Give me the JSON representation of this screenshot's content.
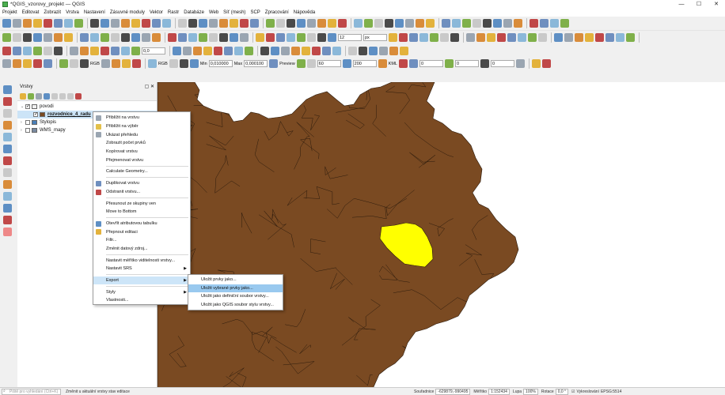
{
  "window": {
    "title": "*QGIS_vzorovy_projekt — QGIS",
    "minimize": "—",
    "maximize": "☐",
    "close": "✕"
  },
  "menubar": [
    "Projekt",
    "Editovat",
    "Zobrazit",
    "Vrstva",
    "Nastavení",
    "Zásuvné moduly",
    "Vektor",
    "Rastr",
    "Databáze",
    "Web",
    "Síť (mesh)",
    "SCP",
    "Zpracování",
    "Nápověda"
  ],
  "toolbar": {
    "rotation_field": "0,0",
    "scale_field": "12",
    "unit_field": "px",
    "identify_label": "RGB",
    "min_label": "Min",
    "min_value": "0,010000",
    "max_label": "Max",
    "max_value": "0,000100",
    "min2_value": "60",
    "max2_value": "200",
    "preview_label": "Preview",
    "kml_label": "KML",
    "z1": "0",
    "z2": "0",
    "z3": "0"
  },
  "layers_panel": {
    "title": "Vrstvy",
    "layers": [
      {
        "name": "povodi",
        "checked": true,
        "expanded": true,
        "level": 0,
        "color": "#f0f0f0"
      },
      {
        "name": "rozvodnice_4_radu",
        "checked": true,
        "expanded": false,
        "level": 1,
        "color": "#7a4a22",
        "selected": true
      },
      {
        "name": "Stylopis",
        "checked": false,
        "expanded": false,
        "level": 0,
        "color": "#4a7fb8"
      },
      {
        "name": "WMS_mapy",
        "checked": false,
        "expanded": false,
        "level": 0,
        "color": "#7a8aa0"
      }
    ]
  },
  "context_menu": {
    "items": [
      {
        "label": "Přiblížit na vrstvu",
        "icon": "zoom-layer-icon",
        "color": "#9aa5b1"
      },
      {
        "label": "Přiblížit na výběr",
        "icon": "zoom-selection-icon",
        "color": "#e3c04a"
      },
      {
        "label": "Ukázat přehledu",
        "icon": "overview-icon",
        "color": "#9aa5b1"
      },
      {
        "label": "Zobrazit počet prvků",
        "icon": "",
        "color": ""
      },
      {
        "label": "Kopírovat vrstvu",
        "icon": "",
        "color": ""
      },
      {
        "label": "Přejmenovat vrstvu",
        "icon": "",
        "color": ""
      },
      {
        "sep": true
      },
      {
        "label": "Calculate Geometry...",
        "icon": "",
        "color": ""
      },
      {
        "sep": true
      },
      {
        "label": "Duplikovat vrstvu",
        "icon": "duplicate-layer-icon",
        "color": "#6f8fbf"
      },
      {
        "label": "Odstranit vrstvu...",
        "icon": "remove-layer-icon",
        "color": "#c04848"
      },
      {
        "sep": true
      },
      {
        "label": "Přesunout ze skupiny ven",
        "icon": "",
        "color": ""
      },
      {
        "label": "Move to Bottom",
        "icon": "",
        "color": ""
      },
      {
        "sep": true
      },
      {
        "label": "Otevřít atributovou tabulku",
        "icon": "attribute-table-icon",
        "color": "#5e8fc4"
      },
      {
        "label": "Přepnout editaci",
        "icon": "toggle-edit-icon",
        "color": "#e3b23c"
      },
      {
        "label": "Filtr...",
        "icon": "",
        "color": ""
      },
      {
        "label": "Změnit datový zdroj...",
        "icon": "",
        "color": ""
      },
      {
        "sep": true
      },
      {
        "label": "Nastavit měřítko viditelnosti vrstvy...",
        "icon": "",
        "color": ""
      },
      {
        "label": "Nastavit SRS",
        "icon": "",
        "color": "",
        "submenu": true
      },
      {
        "sep": true
      },
      {
        "label": "Export",
        "icon": "",
        "color": "",
        "submenu": true,
        "highlighted": true
      },
      {
        "sep": true
      },
      {
        "label": "Styly",
        "icon": "",
        "color": "",
        "submenu": true
      },
      {
        "label": "Vlastnosti...",
        "icon": "",
        "color": ""
      }
    ]
  },
  "export_submenu": {
    "items": [
      {
        "label": "Uložit prvky jako...",
        "highlighted": false
      },
      {
        "label": "Uložit vybrané prvky jako...",
        "highlighted": true
      },
      {
        "label": "Uložit jako definiční soubor vrstvy...",
        "highlighted": false
      },
      {
        "label": "Uložit jako QGIS soubor stylu vrstvy...",
        "highlighted": false
      }
    ]
  },
  "map": {
    "background": "#ffffff",
    "fill": "#7a4a22",
    "stroke": "#2b1a0c",
    "selected_fill": "#ffff00"
  },
  "statusbar": {
    "locator_placeholder": "Piště pro vyhledání (Ctrl+K)",
    "message": "Změnit u aktuální vrstvy stav editace",
    "coord_label": "Souřadnice",
    "coord_value": "-629879,-990495",
    "scale_label": "Měřítko",
    "scale_value": "1:152434",
    "magnifier_label": "Lupa",
    "magnifier_value": "100%",
    "rotation_label": "Rotace",
    "rotation_value": "0,0 °",
    "render_label": "Vykreslování",
    "crs_label": "EPSG:5514"
  }
}
